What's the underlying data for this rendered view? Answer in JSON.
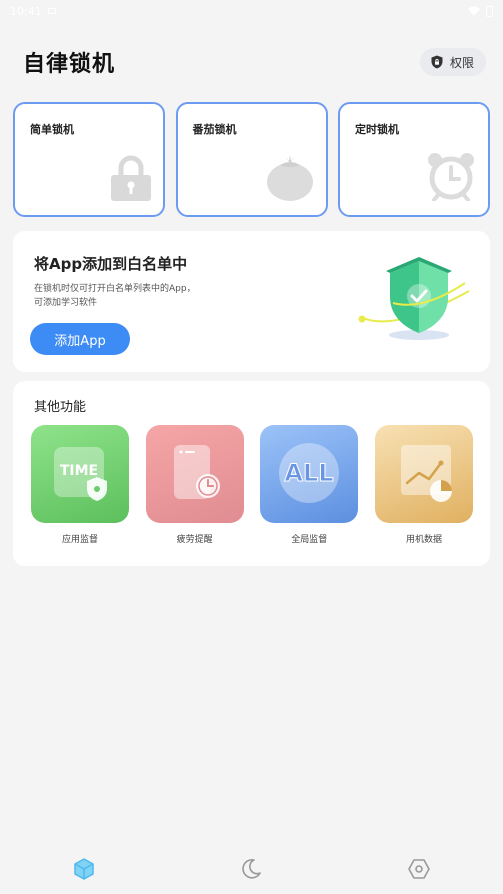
{
  "status_bar": {
    "time": "10:41"
  },
  "header": {
    "title": "自律锁机",
    "permission_label": "权限"
  },
  "lock_modes": [
    {
      "label": "简单锁机",
      "icon": "padlock-icon"
    },
    {
      "label": "番茄锁机",
      "icon": "tomato-icon"
    },
    {
      "label": "定时锁机",
      "icon": "alarm-clock-icon"
    }
  ],
  "whitelist": {
    "title": "将App添加到白名单中",
    "description": "在锁机时仅可打开白名单列表中的App，可添加学习软件",
    "button_label": "添加App"
  },
  "other_features": {
    "title": "其他功能",
    "items": [
      {
        "label": "应用监督",
        "tile_text": "TIME",
        "icon": "app-monitor-icon"
      },
      {
        "label": "疲劳提醒",
        "icon": "fatigue-reminder-icon"
      },
      {
        "label": "全局监督",
        "tile_text": "ALL",
        "icon": "global-monitor-icon"
      },
      {
        "label": "用机数据",
        "icon": "usage-data-icon"
      }
    ]
  },
  "tab_bar": {
    "tabs": [
      {
        "icon": "cube-icon",
        "active": true
      },
      {
        "icon": "moon-icon",
        "active": false
      },
      {
        "icon": "hexagon-settings-icon",
        "active": false
      }
    ]
  },
  "colors": {
    "accent": "#3d8cf5",
    "card_border": "#6e9bf2",
    "background": "#f4f4f5",
    "active_tab": "#4fb8ec"
  }
}
